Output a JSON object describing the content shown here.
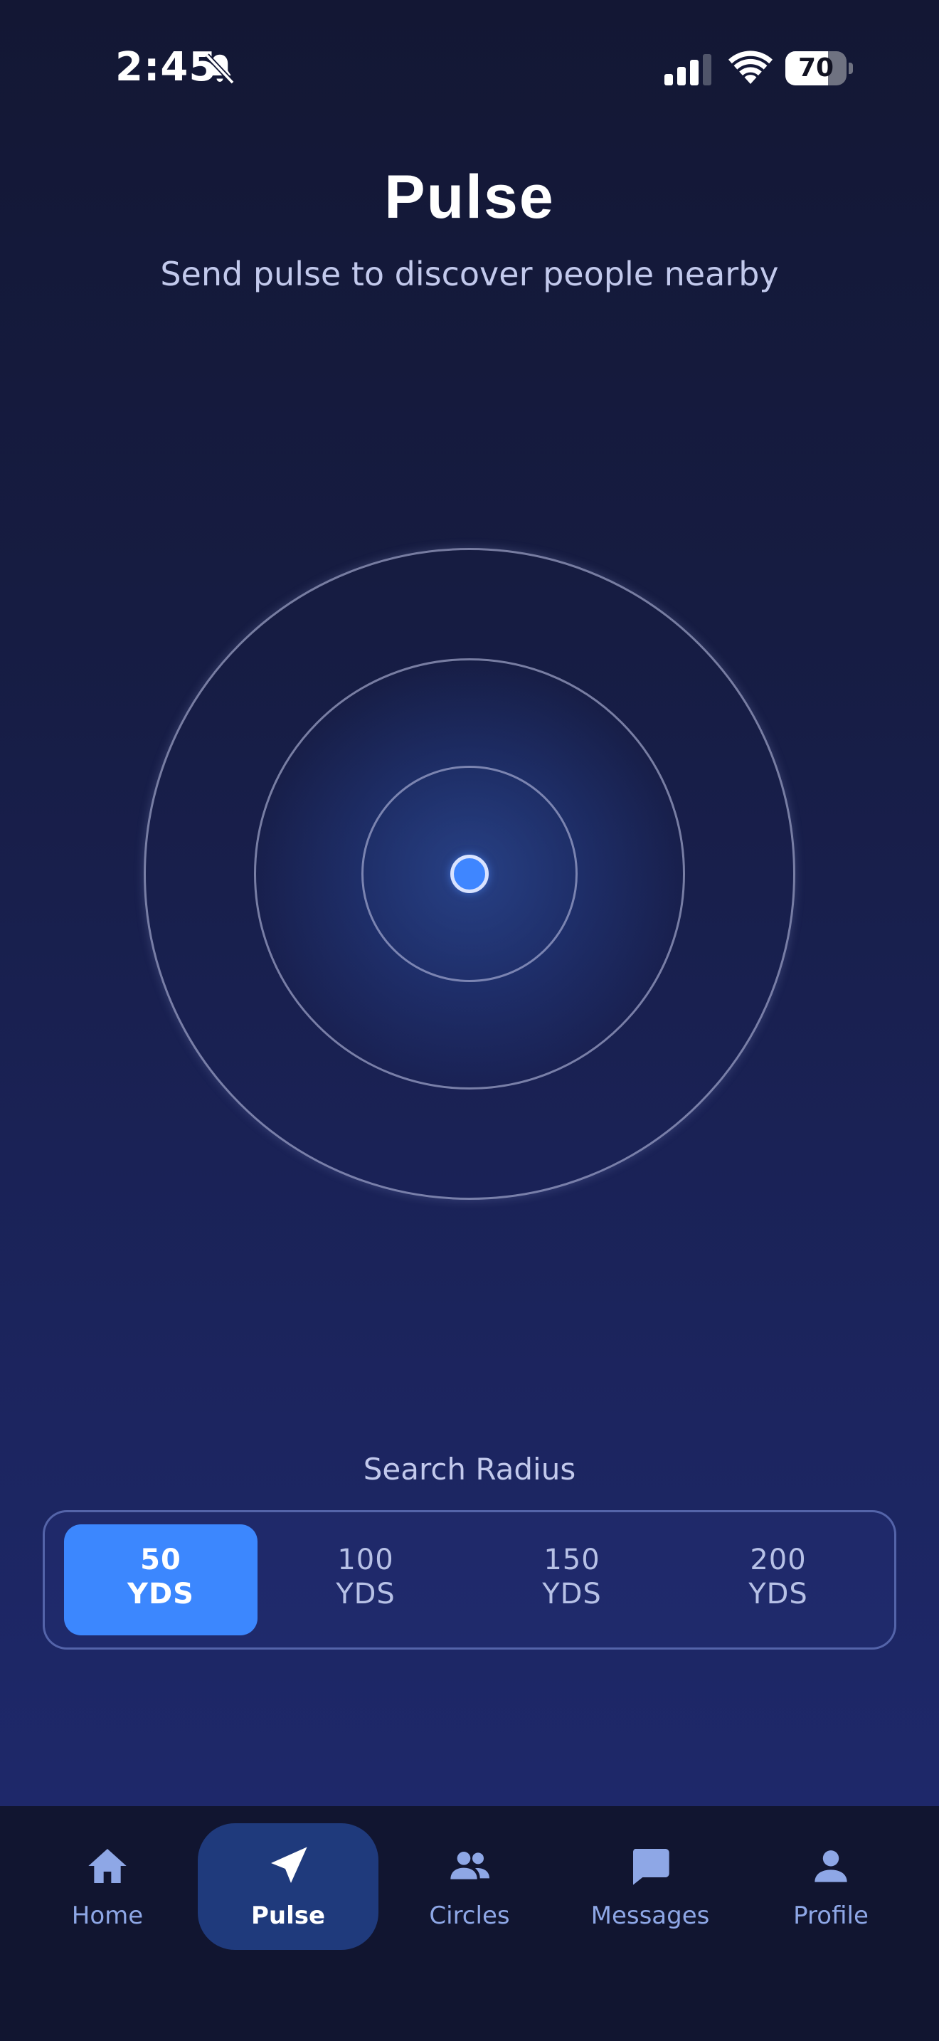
{
  "status_bar": {
    "time": "2:45",
    "battery_percent": "70",
    "battery_level": 0.7,
    "icons": [
      "bell-slash-icon",
      "cellular-signal-icon",
      "wifi-icon",
      "battery-icon"
    ]
  },
  "header": {
    "title": "Pulse",
    "subtitle": "Send pulse to discover people nearby"
  },
  "radar": {
    "rings": 3,
    "center_marker": "user-location-dot",
    "accent_color": "#3f86ff"
  },
  "search_radius": {
    "label": "Search Radius",
    "selected_index": 0,
    "options": [
      {
        "value": "50",
        "unit": "YDS"
      },
      {
        "value": "100",
        "unit": "YDS"
      },
      {
        "value": "150",
        "unit": "YDS"
      },
      {
        "value": "200",
        "unit": "YDS"
      }
    ]
  },
  "nav": {
    "active": "Pulse",
    "items": [
      {
        "label": "Home",
        "icon": "home-icon"
      },
      {
        "label": "Pulse",
        "icon": "navigation-arrow-icon"
      },
      {
        "label": "Circles",
        "icon": "people-group-icon"
      },
      {
        "label": "Messages",
        "icon": "chat-bubble-icon"
      },
      {
        "label": "Profile",
        "icon": "person-icon"
      }
    ]
  },
  "colors": {
    "background_top": "#131734",
    "background_bottom": "#1f2a70",
    "accent": "#3c87fe",
    "nav_background": "#111530",
    "nav_active": "#1f3a7c",
    "nav_inactive_text": "#8ea7e6"
  }
}
